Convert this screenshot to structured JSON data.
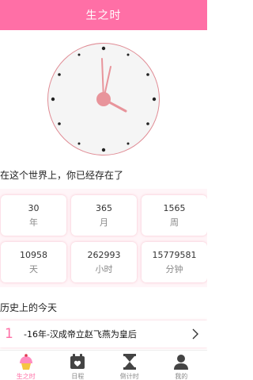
{
  "header": {
    "title": "生之时"
  },
  "lived": {
    "title": "在这个世界上，你已经存在了",
    "stats": [
      {
        "value": "30",
        "unit": "年"
      },
      {
        "value": "365",
        "unit": "月"
      },
      {
        "value": "1565",
        "unit": "周"
      },
      {
        "value": "10958",
        "unit": "天"
      },
      {
        "value": "262993",
        "unit": "小时"
      },
      {
        "value": "15779581",
        "unit": "分钟"
      }
    ]
  },
  "history": {
    "title": "历史上的今天",
    "items": [
      {
        "index": "1",
        "text": "-16年-汉成帝立赵飞燕为皇后"
      }
    ]
  },
  "tabs": [
    {
      "label": "生之时",
      "icon": "cupcake-icon",
      "active": true
    },
    {
      "label": "日程",
      "icon": "calendar-icon",
      "active": false
    },
    {
      "label": "倒计时",
      "icon": "hourglass-icon",
      "active": false
    },
    {
      "label": "我的",
      "icon": "user-icon",
      "active": false
    }
  ],
  "colors": {
    "accent": "#ff6fa6",
    "clock_hands": "#e8949b"
  }
}
